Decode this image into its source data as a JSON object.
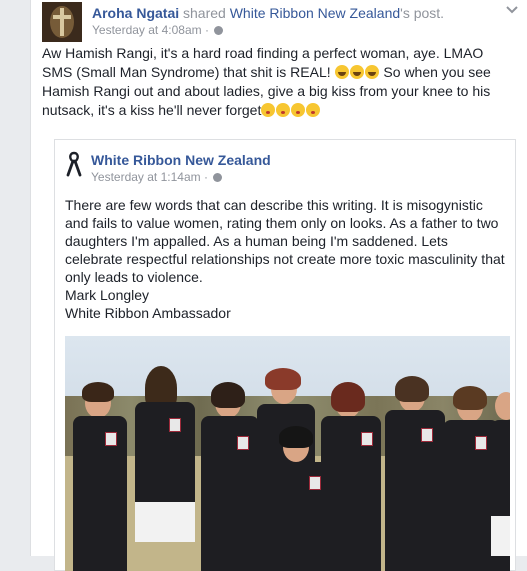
{
  "post": {
    "author": "Aroha Ngatai",
    "shared_text": "shared",
    "shared_page": "White Ribbon New Zealand",
    "shared_suffix": "'s post.",
    "timestamp": "Yesterday at 4:08am",
    "text_part1": "Aw Hamish Rangi, it's a hard road finding a perfect woman, aye. LMAO SMS (Small Man Syndrome) that shit is REAL!",
    "text_part2": " So when you see Hamish Rangi out and about ladies, give a big kiss from your knee to his nutsack, it's a kiss he'll never forget"
  },
  "shared": {
    "page_name": "White Ribbon New Zealand",
    "timestamp": "Yesterday at 1:14am",
    "body": "There are few words that can describe this writing. It is misogynistic and fails to value women, rating them only on looks. As a father to two daughters I'm appalled. As a human being I'm saddened. Lets celebrate respectful relationships not create more toxic masculinity that only leads to violence.",
    "signature_name": "Mark Longley",
    "signature_title": "White Ribbon Ambassador"
  },
  "icons": {
    "laugh_emoji_count": 3,
    "kiss_emoji_count": 4,
    "privacy": "globe-icon",
    "menu": "chevron-down-icon",
    "ribbon": "white-ribbon-icon"
  },
  "colors": {
    "link": "#365899",
    "meta": "#90949c",
    "text": "#1d2129"
  }
}
